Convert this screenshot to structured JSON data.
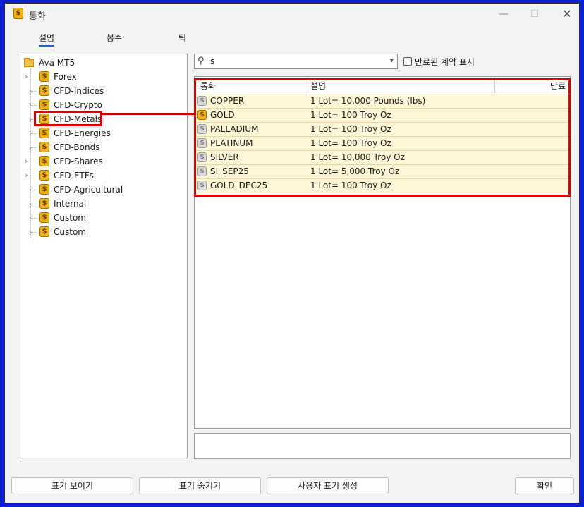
{
  "window": {
    "title": "통화"
  },
  "tabs": [
    {
      "label": "설명"
    },
    {
      "label": "봉수"
    },
    {
      "label": "틱"
    }
  ],
  "tree": {
    "root": "Ava MT5",
    "items": [
      {
        "label": "Forex",
        "expandable": true
      },
      {
        "label": "CFD-Indices",
        "expandable": false
      },
      {
        "label": "CFD-Crypto",
        "expandable": false
      },
      {
        "label": "CFD-Metals",
        "expandable": false,
        "selected": true
      },
      {
        "label": "CFD-Energies",
        "expandable": false
      },
      {
        "label": "CFD-Bonds",
        "expandable": false
      },
      {
        "label": "CFD-Shares",
        "expandable": true
      },
      {
        "label": "CFD-ETFs",
        "expandable": true
      },
      {
        "label": "CFD-Agricultural",
        "expandable": false
      },
      {
        "label": "Internal",
        "expandable": false
      },
      {
        "label": "Custom",
        "expandable": false
      },
      {
        "label": "Custom",
        "expandable": false
      }
    ]
  },
  "search": {
    "value": "s"
  },
  "show_expired": {
    "label": "만료된 계약 표시",
    "checked": false
  },
  "grid": {
    "columns": [
      "통화",
      "설명",
      "만료"
    ],
    "rows": [
      {
        "symbol": "COPPER",
        "description": "1 Lot= 10,000 Pounds (lbs)",
        "expiry": "",
        "icon": "grey"
      },
      {
        "symbol": "GOLD",
        "description": "1 Lot= 100 Troy Oz",
        "expiry": "",
        "icon": "gold"
      },
      {
        "symbol": "PALLADIUM",
        "description": "1 Lot= 100 Troy Oz",
        "expiry": "",
        "icon": "grey"
      },
      {
        "symbol": "PLATINUM",
        "description": "1 Lot= 100 Troy Oz",
        "expiry": "",
        "icon": "grey"
      },
      {
        "symbol": "SILVER",
        "description": "1 Lot= 10,000 Troy Oz",
        "expiry": "",
        "icon": "grey"
      },
      {
        "symbol": "SI_SEP25",
        "description": "1 Lot= 5,000 Troy Oz",
        "expiry": "",
        "icon": "grey"
      },
      {
        "symbol": "GOLD_DEC25",
        "description": "1 Lot= 100 Troy Oz",
        "expiry": "",
        "icon": "grey"
      }
    ]
  },
  "buttons": {
    "show": "표기 보이기",
    "hide": "표기 숨기기",
    "create": "사용자 표기 생성",
    "ok": "확인"
  },
  "colors": {
    "highlight": "#e00000",
    "row_bg": "#fff7d6",
    "coin": "#f4b400"
  }
}
